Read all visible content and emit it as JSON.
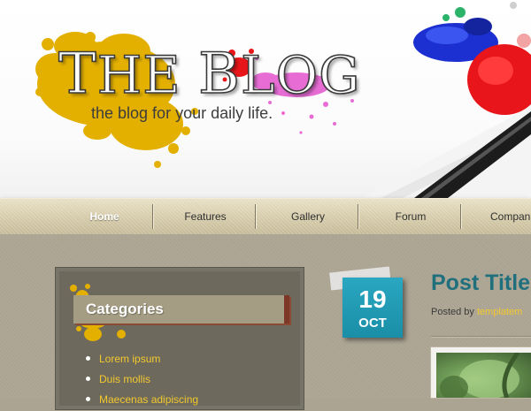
{
  "header": {
    "logo_title_cap1": "T",
    "logo_title_rest1": "HE",
    "logo_title_cap2": "B",
    "logo_title_rest2": "LOG",
    "tagline": "the blog for your daily life."
  },
  "nav": {
    "items": [
      {
        "label": "Home",
        "active": true
      },
      {
        "label": "Features"
      },
      {
        "label": "Gallery"
      },
      {
        "label": "Forum"
      },
      {
        "label": "Compan"
      }
    ]
  },
  "sidebar": {
    "title": "Categories",
    "items": [
      "Lorem ipsum",
      "Duis mollis",
      "Maecenas adipiscing"
    ]
  },
  "post": {
    "date_day": "19",
    "date_month": "OCT",
    "title": "Post Title",
    "posted_by_prefix": "Posted by ",
    "author": "templatem"
  },
  "colors": {
    "accent_teal": "#1a8ea7",
    "title_teal": "#1f6f7d",
    "link_yellow": "#f3c82e",
    "paint_yellow": "#e3b000",
    "paint_red": "#e8161a",
    "paint_blue": "#1c2fd0",
    "paint_magenta": "#e455cf"
  }
}
